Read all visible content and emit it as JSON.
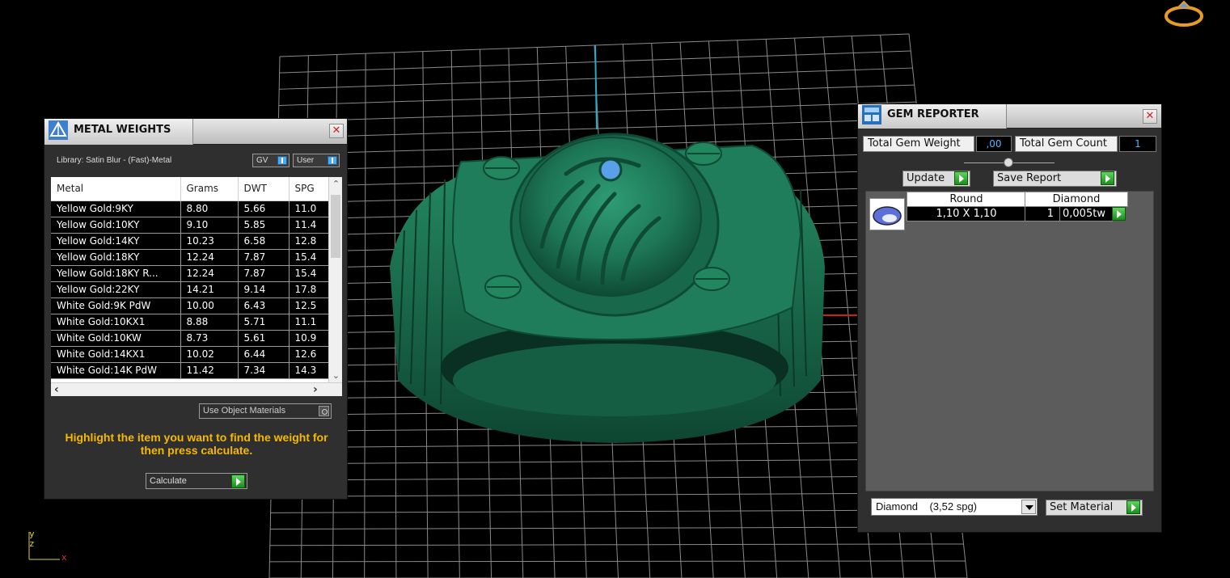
{
  "metal_weights": {
    "title": "METAL WEIGHTS",
    "library_label": "Library: Satin Blur - (Fast)-Metal",
    "gv_label": "GV",
    "user_label": "User",
    "columns": [
      "Metal",
      "Grams",
      "DWT",
      "SPG"
    ],
    "rows": [
      [
        "Yellow Gold:9KY",
        "8.80",
        "5.66",
        "11.0"
      ],
      [
        "Yellow Gold:10KY",
        "9.10",
        "5.85",
        "11.4"
      ],
      [
        "Yellow Gold:14KY",
        "10.23",
        "6.58",
        "12.8"
      ],
      [
        "Yellow Gold:18KY",
        "12.24",
        "7.87",
        "15.4"
      ],
      [
        "Yellow Gold:18KY R...",
        "12.24",
        "7.87",
        "15.4"
      ],
      [
        "Yellow Gold:22KY",
        "14.21",
        "9.14",
        "17.8"
      ],
      [
        "White Gold:9K PdW",
        "10.00",
        "6.43",
        "12.5"
      ],
      [
        "White Gold:10KX1",
        "8.88",
        "5.71",
        "11.1"
      ],
      [
        "White Gold:10KW",
        "8.73",
        "5.61",
        "10.9"
      ],
      [
        "White Gold:14KX1",
        "10.02",
        "6.44",
        "12.6"
      ],
      [
        "White Gold:14K PdW",
        "11.42",
        "7.34",
        "14.3"
      ]
    ],
    "use_object_materials": "Use Object Materials",
    "hint": "Highlight the item you want to find the weight for then press calculate.",
    "calculate_label": "Calculate"
  },
  "gem_reporter": {
    "title": "GEM REPORTER",
    "total_weight_label": "Total Gem Weight",
    "total_weight_value": ",00",
    "total_count_label": "Total Gem Count",
    "total_count_value": "1",
    "update_label": "Update",
    "save_report_label": "Save Report",
    "gems": [
      {
        "shape": "Round",
        "material": "Diamond",
        "size": "1,10 X 1,10",
        "count": "1",
        "weight": "0,005tw"
      }
    ],
    "material_select": "Diamond    (3,52 spg)",
    "set_material_label": "Set Material"
  },
  "axis": {
    "y": "y",
    "z": "z",
    "x": "x"
  },
  "colors": {
    "ring": "#1e7a5a",
    "grid": "#8a8a8a",
    "hint_text": "#f7b800",
    "gem_value": "#4db8ff"
  }
}
